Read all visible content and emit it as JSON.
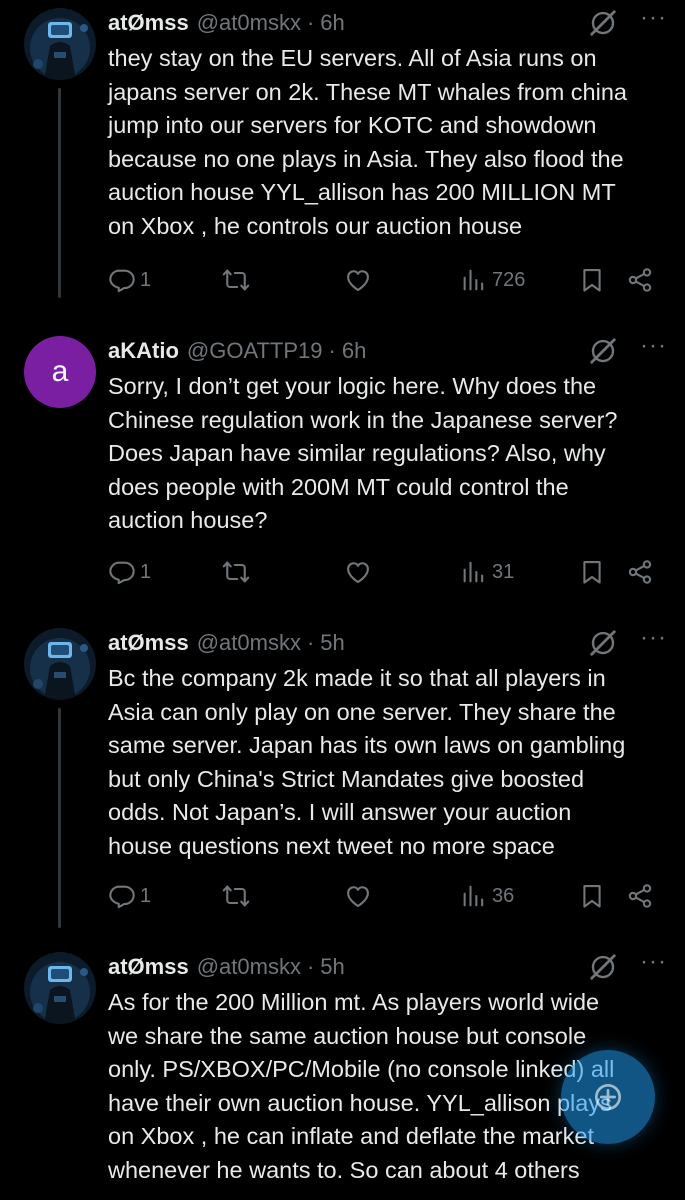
{
  "tweets": [
    {
      "name": "atØmss",
      "handle": "@at0mskx",
      "time": "6h",
      "avatar": "profile-avatar",
      "text": "they stay on the EU servers. All of Asia runs on\njapans server on 2k. These MT whales from china\njump into our servers for KOTC and showdown\nbecause no one plays in Asia. They also flood the\nauction house YYL_allison has 200 MILLION MT\non Xbox , he controls our auction house",
      "replies": "1",
      "reposts": "",
      "likes": "",
      "views": "726"
    },
    {
      "name": "aKAtio",
      "handle": "@GOATTP19",
      "time": "6h",
      "avatar_letter": "a",
      "text": "Sorry, I don’t get your logic here. Why does the\nChinese regulation work in the Japanese server?\nDoes Japan have similar regulations? Also, why\ndoes people with 200M MT could control the\nauction house?",
      "replies": "1",
      "reposts": "",
      "likes": "",
      "views": "31"
    },
    {
      "name": "atØmss",
      "handle": "@at0mskx",
      "time": "5h",
      "avatar": "profile-avatar",
      "text": "Bc the company 2k made it so that all players in\nAsia can only play on one server. They share the\nsame server. Japan has its own laws on gambling\nbut only China's Strict Mandates give boosted\nodds. Not Japan’s. I will answer your auction\nhouse questions next tweet no more space",
      "replies": "1",
      "reposts": "",
      "likes": "",
      "views": "36"
    },
    {
      "name": "atØmss",
      "handle": "@at0mskx",
      "time": "5h",
      "avatar": "profile-avatar",
      "text": "As for the 200 Million mt. As players world wide\nwe share the same auction house but console\nonly. PS/XBOX/PC/Mobile (no console linked) all\nhave their own auction house. YYL_allison plays\non Xbox , he can inflate and deflate the market\nwhenever he wants to. So can about 4 others"
    }
  ],
  "separator": "·",
  "more_label": "···",
  "colors": {
    "background": "#000000",
    "text": "#e7e9ea",
    "muted": "#71767b",
    "thread_line": "#333639",
    "letter_avatar": "#7b1fa2",
    "fab": "#1d9bf0"
  },
  "icons": {
    "grok": "grok-slash-icon",
    "reply": "reply-bubble-icon",
    "repost": "repost-arrows-icon",
    "like": "heart-icon",
    "views": "views-bar-chart-icon",
    "bookmark": "bookmark-icon",
    "share": "share-icon",
    "fab": "compose-fab-icon"
  }
}
